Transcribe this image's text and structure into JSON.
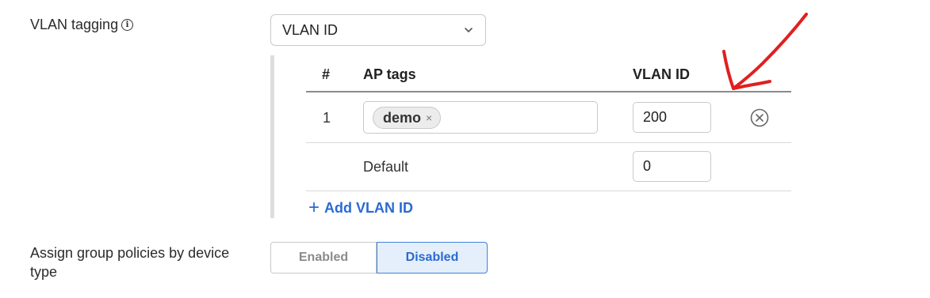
{
  "vlan_tagging": {
    "label": "VLAN tagging",
    "info_icon": "info-icon",
    "select_value": "VLAN ID"
  },
  "table": {
    "headers": {
      "num": "#",
      "ap_tags": "AP tags",
      "vlan_id": "VLAN ID"
    },
    "rows": [
      {
        "num": "1",
        "tag": "demo",
        "tag_remove": "×",
        "vlan_id": "200"
      }
    ],
    "default_row": {
      "label": "Default",
      "vlan_id": "0"
    },
    "add_label": "Add VLAN ID",
    "add_plus": "+"
  },
  "group_policies": {
    "label_line1": "Assign group policies by device",
    "label_line2": "type",
    "options": [
      "Enabled",
      "Disabled"
    ],
    "selected": "Disabled"
  },
  "colors": {
    "accent": "#2a6ad1",
    "selected_bg": "#e4effb",
    "annotation": "#e02020"
  }
}
